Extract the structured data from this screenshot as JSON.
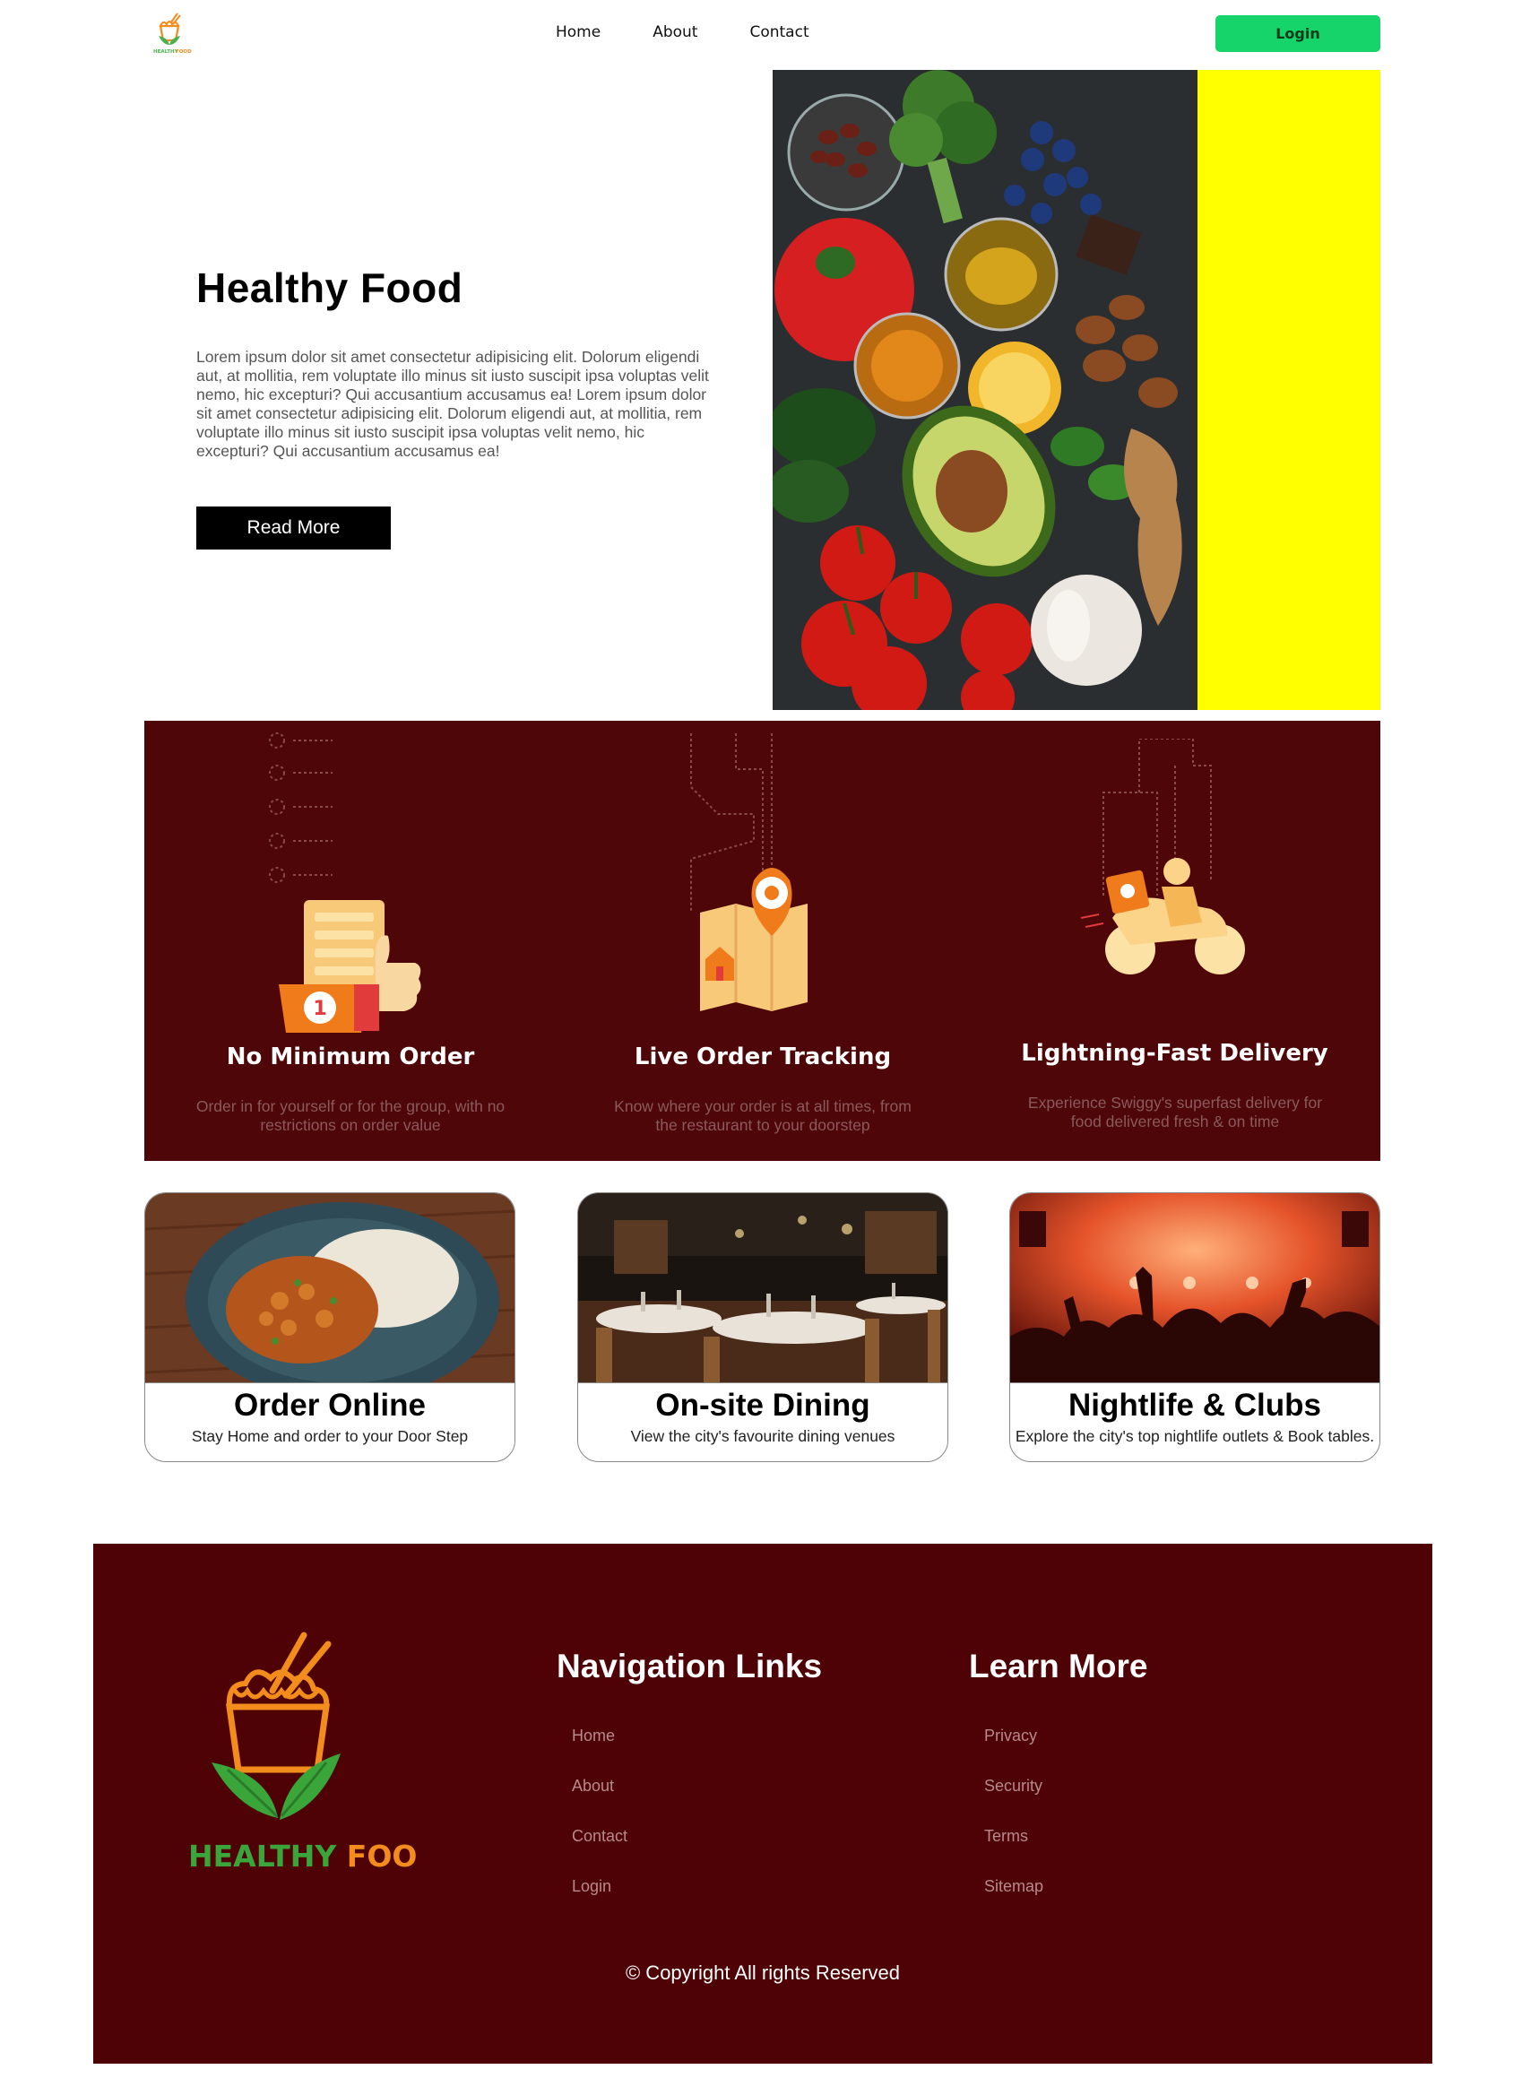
{
  "header": {
    "nav": [
      {
        "label": "Home"
      },
      {
        "label": "About"
      },
      {
        "label": "Contact"
      }
    ],
    "login_label": "Login"
  },
  "hero": {
    "title": "Healthy Food",
    "paragraph": "Lorem ipsum dolor sit amet consectetur adipisicing elit. Dolorum eligendi aut, at mollitia, rem voluptate illo minus sit iusto suscipit ipsa voluptas velit nemo, hic excepturi? Qui accusantium accusamus ea! Lorem ipsum dolor sit amet consectetur adipisicing elit. Dolorum eligendi aut, at mollitia, rem voluptate illo minus sit iusto suscipit ipsa voluptas velit nemo, hic excepturi? Qui accusantium accusamus ea!",
    "button_label": "Read More"
  },
  "features": [
    {
      "title": "No Minimum Order",
      "text": "Order in for yourself or for the group, with no restrictions on order value",
      "badge": "1"
    },
    {
      "title": "Live Order Tracking",
      "text": "Know where your order is at all times, from the restaurant to your doorstep"
    },
    {
      "title": "Lightning-Fast Delivery",
      "text": "Experience Swiggy's superfast delivery for food delivered fresh & on time"
    }
  ],
  "cards": [
    {
      "title": "Order Online",
      "subtitle": "Stay Home and order to your Door Step"
    },
    {
      "title": "On-site Dining",
      "subtitle": "View the city's favourite dining venues"
    },
    {
      "title": "Nightlife & Clubs",
      "subtitle": "Explore the city's top nightlife outlets & Book tables."
    }
  ],
  "footer": {
    "logo_text": "HEALTHY FOOD",
    "nav_heading": "Navigation Links",
    "nav_links": [
      {
        "label": "Home"
      },
      {
        "label": "About"
      },
      {
        "label": "Contact"
      },
      {
        "label": "Login"
      }
    ],
    "learn_heading": "Learn More",
    "learn_links": [
      {
        "label": "Privacy"
      },
      {
        "label": "Security"
      },
      {
        "label": "Terms"
      },
      {
        "label": "Sitemap"
      }
    ],
    "copyright": "© Copyright All rights Reserved"
  },
  "colors": {
    "maroon": "#4e0608",
    "login_green": "#16d36a",
    "yellow": "#ffff00",
    "orange": "#f28c1c",
    "leaf_green": "#4caf50"
  }
}
